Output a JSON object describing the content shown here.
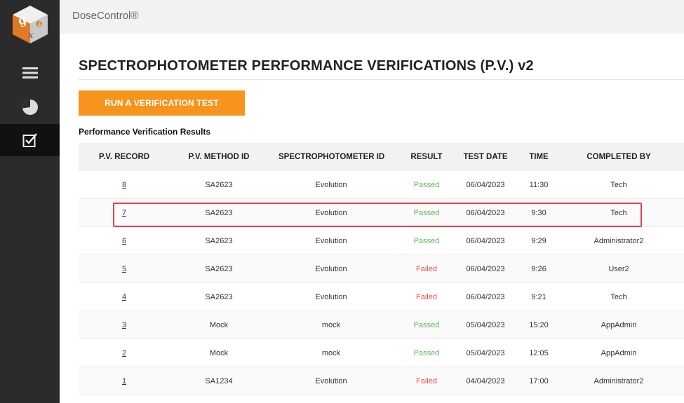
{
  "app": {
    "name": "DoseControl®"
  },
  "sidebar": {
    "items": [
      {
        "icon": "hamburger-menu-icon",
        "active": false
      },
      {
        "icon": "pie-chart-icon",
        "active": false
      },
      {
        "icon": "checkbox-icon",
        "active": true
      }
    ]
  },
  "page": {
    "title": "SPECTROPHOTOMETER PERFORMANCE VERIFICATIONS (P.V.) v2",
    "run_button_label": "RUN A VERIFICATION TEST",
    "section_title": "Performance Verification Results"
  },
  "table": {
    "headers": [
      "P.V. RECORD",
      "P.V. METHOD ID",
      "SPECTROPHOTOMETER ID",
      "RESULT",
      "TEST DATE",
      "TIME",
      "COMPLETED BY"
    ],
    "rows": [
      {
        "record": "8",
        "method": "SA2623",
        "spectro": "Evolution",
        "result": "Passed",
        "date": "06/04/2023",
        "time": "11:30",
        "by": "Tech"
      },
      {
        "record": "7",
        "method": "SA2623",
        "spectro": "Evolution",
        "result": "Passed",
        "date": "06/04/2023",
        "time": "9:30",
        "by": "Tech"
      },
      {
        "record": "6",
        "method": "SA2623",
        "spectro": "Evolution",
        "result": "Passed",
        "date": "06/04/2023",
        "time": "9:29",
        "by": "Administrator2"
      },
      {
        "record": "5",
        "method": "SA2623",
        "spectro": "Evolution",
        "result": "Failed",
        "date": "06/04/2023",
        "time": "9:26",
        "by": "User2"
      },
      {
        "record": "4",
        "method": "SA2623",
        "spectro": "Evolution",
        "result": "Failed",
        "date": "06/04/2023",
        "time": "9:21",
        "by": "Tech"
      },
      {
        "record": "3",
        "method": "Mock",
        "spectro": "mock",
        "result": "Passed",
        "date": "05/04/2023",
        "time": "15:20",
        "by": "AppAdmin"
      },
      {
        "record": "2",
        "method": "Mock",
        "spectro": "mock",
        "result": "Passed",
        "date": "05/04/2023",
        "time": "12:05",
        "by": "AppAdmin"
      },
      {
        "record": "1",
        "method": "SA1234",
        "spectro": "Evolution",
        "result": "Failed",
        "date": "04/04/2023",
        "time": "17:00",
        "by": "Administrator2"
      }
    ],
    "highlighted_row": "7"
  },
  "colors": {
    "accent": "#f7941d",
    "passed": "#5cb85c",
    "failed": "#d9534f",
    "sidebar": "#2b2b2b",
    "highlight": "#e0414a"
  }
}
